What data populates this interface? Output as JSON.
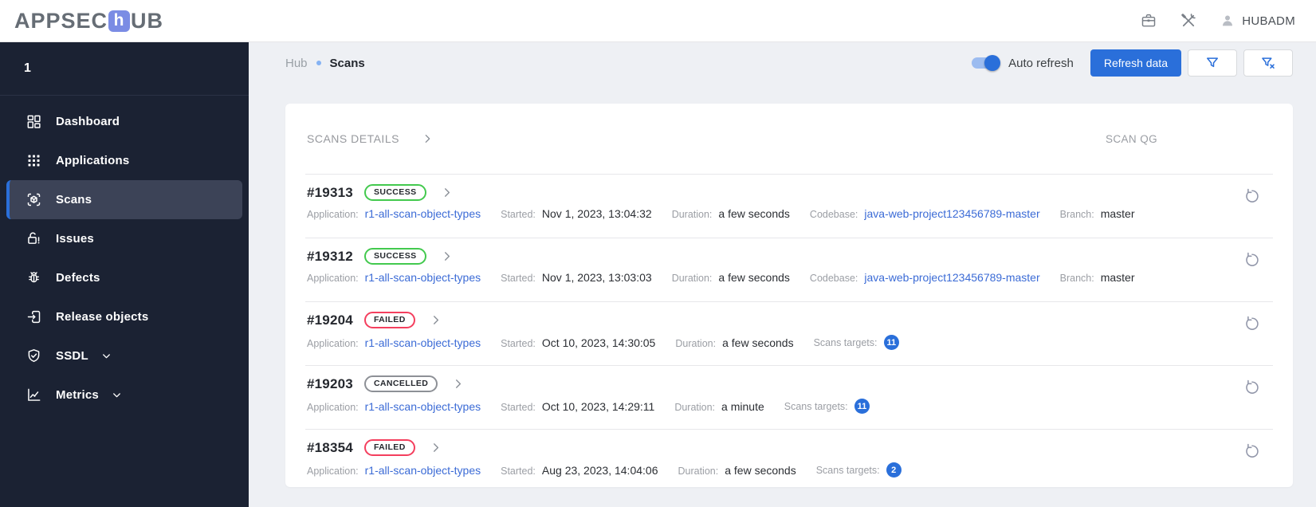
{
  "topbar": {
    "logo_prefix": "APPSEC",
    "logo_accent": "h",
    "logo_suffix": "UB",
    "user": "HUBADM"
  },
  "sidebar": {
    "collapse_label": "1",
    "items": [
      {
        "label": "Dashboard"
      },
      {
        "label": "Applications"
      },
      {
        "label": "Scans"
      },
      {
        "label": "Issues"
      },
      {
        "label": "Defects"
      },
      {
        "label": "Release objects"
      },
      {
        "label": "SSDL"
      },
      {
        "label": "Metrics"
      }
    ]
  },
  "breadcrumb": {
    "root": "Hub",
    "current": "Scans"
  },
  "controls": {
    "auto_refresh_label": "Auto refresh",
    "auto_refresh_on": true,
    "refresh_button_label": "Refresh data"
  },
  "scans": {
    "details_header": "SCANS DETAILS",
    "qg_header": "SCAN QG",
    "rows": [
      {
        "id": "#19313",
        "status": "SUCCESS",
        "fields": {
          "application": {
            "label": "Application:",
            "value": "r1-all-scan-object-types"
          },
          "started": {
            "label": "Started:",
            "value": "Nov 1, 2023, 13:04:32"
          },
          "duration": {
            "label": "Duration:",
            "value": "a few seconds"
          },
          "codebase": {
            "label": "Codebase:",
            "value": "java-web-project123456789-master"
          },
          "branch": {
            "label": "Branch:",
            "value": "master"
          }
        }
      },
      {
        "id": "#19312",
        "status": "SUCCESS",
        "fields": {
          "application": {
            "label": "Application:",
            "value": "r1-all-scan-object-types"
          },
          "started": {
            "label": "Started:",
            "value": "Nov 1, 2023, 13:03:03"
          },
          "duration": {
            "label": "Duration:",
            "value": "a few seconds"
          },
          "codebase": {
            "label": "Codebase:",
            "value": "java-web-project123456789-master"
          },
          "branch": {
            "label": "Branch:",
            "value": "master"
          }
        }
      },
      {
        "id": "#19204",
        "status": "FAILED",
        "fields": {
          "application": {
            "label": "Application:",
            "value": "r1-all-scan-object-types"
          },
          "started": {
            "label": "Started:",
            "value": "Oct 10, 2023, 14:30:05"
          },
          "duration": {
            "label": "Duration:",
            "value": "a few seconds"
          },
          "scans_targets": {
            "label": "Scans targets:",
            "count": "11"
          }
        }
      },
      {
        "id": "#19203",
        "status": "CANCELLED",
        "fields": {
          "application": {
            "label": "Application:",
            "value": "r1-all-scan-object-types"
          },
          "started": {
            "label": "Started:",
            "value": "Oct 10, 2023, 14:29:11"
          },
          "duration": {
            "label": "Duration:",
            "value": "a minute"
          },
          "scans_targets": {
            "label": "Scans targets:",
            "count": "11"
          }
        }
      },
      {
        "id": "#18354",
        "status": "FAILED",
        "fields": {
          "application": {
            "label": "Application:",
            "value": "r1-all-scan-object-types"
          },
          "started": {
            "label": "Started:",
            "value": "Aug 23, 2023, 14:04:06"
          },
          "duration": {
            "label": "Duration:",
            "value": "a few seconds"
          },
          "scans_targets": {
            "label": "Scans targets:",
            "count": "2"
          }
        }
      }
    ]
  },
  "colors": {
    "accent_blue": "#2a6fda",
    "link_blue": "#3b6bd6",
    "success_green": "#43c94e",
    "failed_red": "#f43f5e",
    "cancelled_gray": "#8d9096",
    "sidebar_bg": "#1b2233",
    "logo_accent_bg": "#7b8ce4",
    "page_bg": "#eef0f4"
  }
}
